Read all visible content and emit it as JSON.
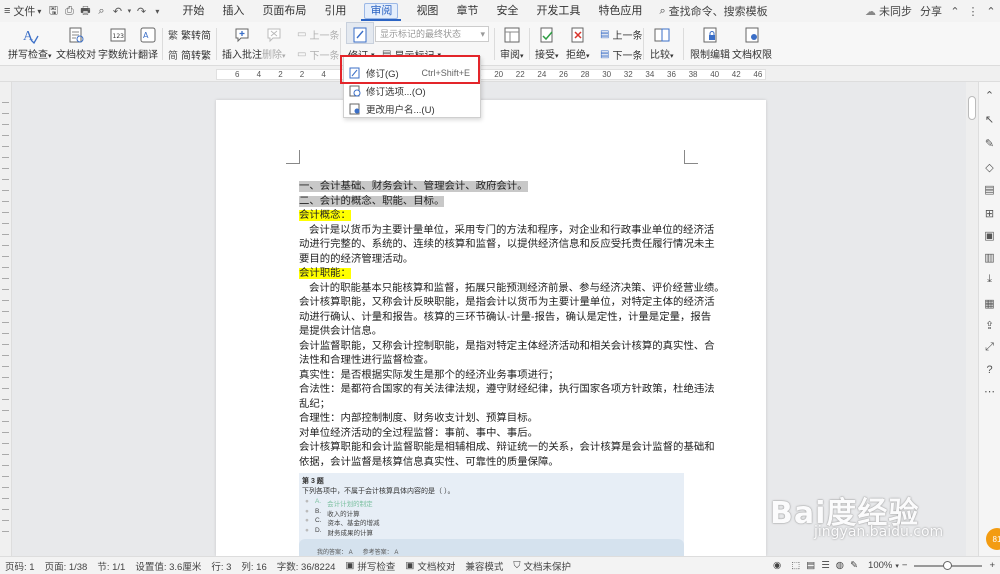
{
  "menubar": {
    "file": "文件",
    "tabs": [
      "开始",
      "插入",
      "页面布局",
      "引用",
      "审阅",
      "视图",
      "章节",
      "安全",
      "开发工具",
      "特色应用"
    ],
    "active_tab": "审阅",
    "search": "查找命令、搜索模板",
    "sync": "未同步",
    "share": "分享"
  },
  "ribbon": {
    "spellcheck": "拼写检查",
    "doc_proof": "文档校对",
    "word_count": "字数统计",
    "translate": "翻译",
    "trad_to_simp": "繁转简",
    "simp_to_trad": "简转繁",
    "insert_comment": "插入批注",
    "delete": "删除",
    "prev": "上一条",
    "next": "下一条",
    "track": "修订",
    "show_markup": "显示标记的最终状态",
    "show_marks": "显示标记",
    "review": "审阅",
    "accept": "接受",
    "reject": "拒绝",
    "prev2": "上一条",
    "next2": "下一条",
    "compare": "比较",
    "restrict": "限制编辑",
    "doc_perm": "文档权限"
  },
  "ruler": {
    "numbers": [
      "6",
      "4",
      "2",
      "2",
      "4",
      "6",
      "8",
      "10",
      "12",
      "14",
      "16",
      "18",
      "20",
      "22",
      "24",
      "26",
      "28",
      "30",
      "32",
      "34",
      "36",
      "38",
      "40",
      "42",
      "46"
    ]
  },
  "dropdown": {
    "items": [
      {
        "label": "修订(G)",
        "shortcut": "Ctrl+Shift+E"
      },
      {
        "label": "修订选项...(O)",
        "shortcut": ""
      },
      {
        "label": "更改用户名...(U)",
        "shortcut": ""
      }
    ]
  },
  "document": {
    "lines": [
      {
        "text": "一、会计基础、财务会计、管理会计、政府会计。",
        "style": "gray"
      },
      {
        "text": "二、会计的概念、职能、目标。",
        "style": "gray"
      },
      {
        "text": "会计概念：",
        "style": "yellow"
      },
      {
        "text": "会计是以货币为主要计量单位，采用专门的方法和程序，对企业和行政事业单位的经济活",
        "style": "indent"
      },
      {
        "text": "动进行完整的、系统的、连续的核算和监督，以提供经济信息和反应受托责任履行情况未主",
        "style": ""
      },
      {
        "text": "要目的的经济管理活动。",
        "style": ""
      },
      {
        "text": "会计职能：",
        "style": "yellow"
      },
      {
        "text": "会计的职能基本只能核算和监督，拓展只能预测经济前景、参与经济决策、评价经营业绩。",
        "style": "indent"
      },
      {
        "text": "会计核算职能，又称会计反映职能，是指会计以货币为主要计量单位，对特定主体的经济活",
        "style": ""
      },
      {
        "text": "动进行确认、计量和报告。核算的三环节确认-计量-报告，确认是定性，计量是定量，报告",
        "style": ""
      },
      {
        "text": "是提供会计信息。",
        "style": ""
      },
      {
        "text": "会计监督职能，又称会计控制职能，是指对特定主体经济活动和相关会计核算的真实性、合",
        "style": ""
      },
      {
        "text": "法性和合理性进行监督检查。",
        "style": ""
      },
      {
        "text": "真实性：是否根据实际发生是那个的经济业务事项进行；",
        "style": ""
      },
      {
        "text": "合法性：是都符合国家的有关法律法规，遵守财经纪律，执行国家各项方针政策，杜绝违法",
        "style": ""
      },
      {
        "text": "乱纪；",
        "style": ""
      },
      {
        "text": "合理性：内部控制制度、财务收支计划、预算目标。",
        "style": ""
      },
      {
        "text": "对单位经济活动的全过程监督：事前、事中、事后。",
        "style": ""
      },
      {
        "text": "会计核算职能和会计监督职能是相辅相成、辩证统一的关系，会计核算是会计监督的基础和",
        "style": ""
      },
      {
        "text": "依据，会计监督是核算信息真实性、可靠性的质量保障。",
        "style": ""
      }
    ]
  },
  "quiz": {
    "title": "第 3 题",
    "question": "下列各项中，不属于会计核算具体内容的是（ ）。",
    "options": [
      {
        "key": "A.",
        "text": "会计计划的制定",
        "correct": true
      },
      {
        "key": "B.",
        "text": "收入的计算",
        "correct": false
      },
      {
        "key": "C.",
        "text": "资本、基金的增减",
        "correct": false
      },
      {
        "key": "D.",
        "text": "财务成果的计算",
        "correct": false
      }
    ],
    "my_answer": "我的答案： A",
    "ref_answer": "参考答案： A"
  },
  "statusbar": {
    "page_no": "页码: 1",
    "page": "页面: 1/38",
    "section": "节: 1/1",
    "setting": "设置值: 3.6厘米",
    "row": "行: 3",
    "col": "列: 16",
    "words": "字数: 36/8224",
    "spell": "拼写检查",
    "proof": "文档校对",
    "compat": "兼容模式",
    "unprotected": "文档未保护",
    "zoom": "100%"
  },
  "watermark": {
    "big": "Bai度经验",
    "small": "jingyan.baidu.com"
  }
}
